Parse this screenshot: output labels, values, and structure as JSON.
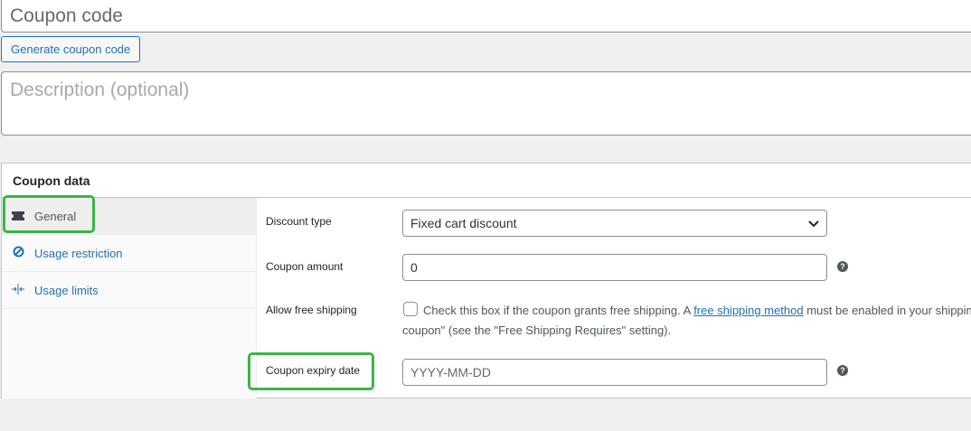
{
  "title_placeholder": "Coupon code",
  "generate_label": "Generate coupon code",
  "description_placeholder": "Description (optional)",
  "panel": {
    "title": "Coupon data",
    "tabs": [
      {
        "label": "General",
        "icon": "ticket-icon"
      },
      {
        "label": "Usage restriction",
        "icon": "prohibited-icon"
      },
      {
        "label": "Usage limits",
        "icon": "arrows-in-icon"
      }
    ]
  },
  "general": {
    "discount_type_label": "Discount type",
    "discount_type_value": "Fixed cart discount",
    "amount_label": "Coupon amount",
    "amount_value": "0",
    "free_shipping_label": "Allow free shipping",
    "free_shipping_text1": "Check this box if the coupon grants free shipping. A ",
    "free_shipping_link": "free shipping method",
    "free_shipping_text2": " must be enabled in your shipping zone and be set to require \"a valid free shipping",
    "free_shipping_text3": "coupon\" (see the \"Free Shipping Requires\" setting).",
    "expiry_label": "Coupon expiry date",
    "expiry_placeholder": "YYYY-MM-DD"
  },
  "colors": {
    "highlight": "#3bb54a",
    "accent": "#2271b1"
  }
}
